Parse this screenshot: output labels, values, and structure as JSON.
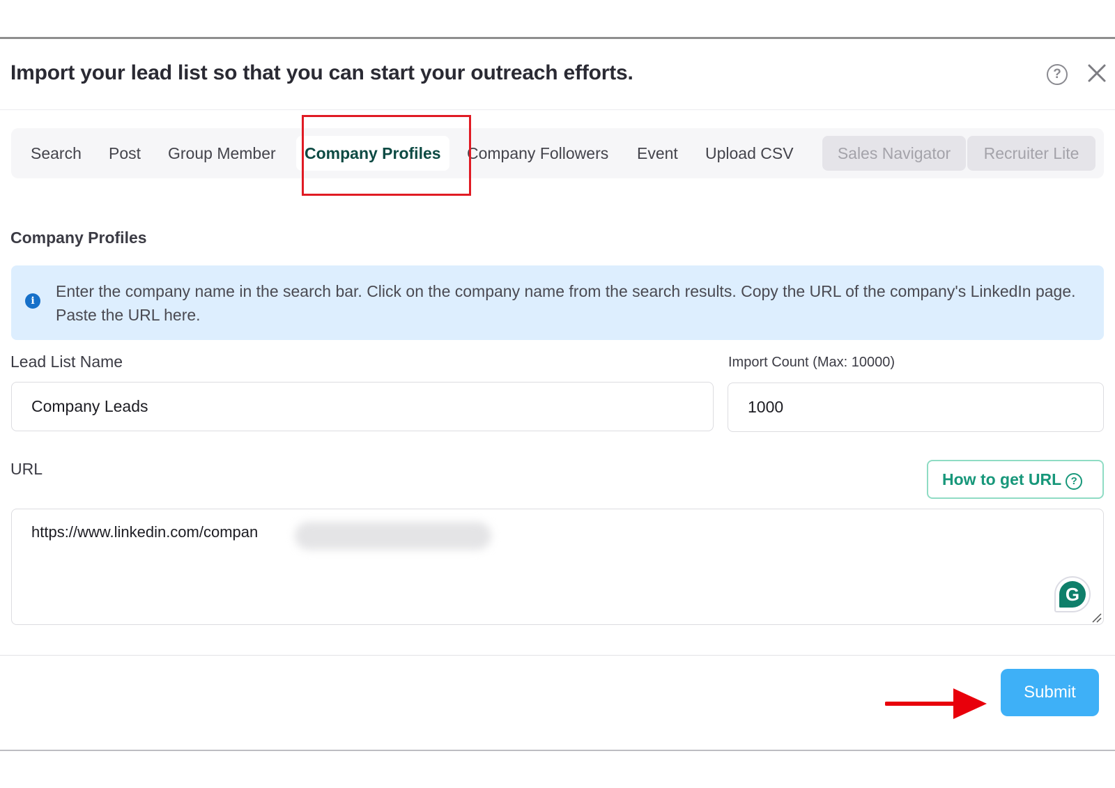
{
  "modal": {
    "title": "Import your lead list so that you can start your outreach efforts.",
    "help_icon": "question-circle-icon",
    "help_glyph": "?",
    "close_icon": "close-x-icon"
  },
  "tabs": [
    {
      "label": "Search",
      "state": "normal"
    },
    {
      "label": "Post",
      "state": "normal"
    },
    {
      "label": "Group Member",
      "state": "normal"
    },
    {
      "label": "Company Profiles",
      "state": "active"
    },
    {
      "label": "Company Followers",
      "state": "normal"
    },
    {
      "label": "Event",
      "state": "normal"
    },
    {
      "label": "Upload CSV",
      "state": "normal"
    },
    {
      "label": "Sales Navigator",
      "state": "disabled"
    },
    {
      "label": "Recruiter Lite",
      "state": "disabled"
    }
  ],
  "section": {
    "title": "Company Profiles",
    "info_icon": "info-icon",
    "info_glyph": "i",
    "info_text": "Enter the company name in the search bar. Click on the company name from the search results. Copy the URL of the company's LinkedIn page. Paste the URL here."
  },
  "form": {
    "lead_list_name": {
      "label": "Lead List Name",
      "value": "Company Leads"
    },
    "import_count": {
      "label": "Import Count (Max: 10000)",
      "value": "1000"
    },
    "url": {
      "label": "URL",
      "value": "https://www.linkedin.com/compan",
      "how_to_label": "How to get URL",
      "how_to_glyph": "?"
    },
    "grammarly_glyph": "G"
  },
  "footer": {
    "submit_label": "Submit"
  },
  "annotations": {
    "highlight_color": "#e01b24",
    "arrow_color": "#e8000b"
  }
}
